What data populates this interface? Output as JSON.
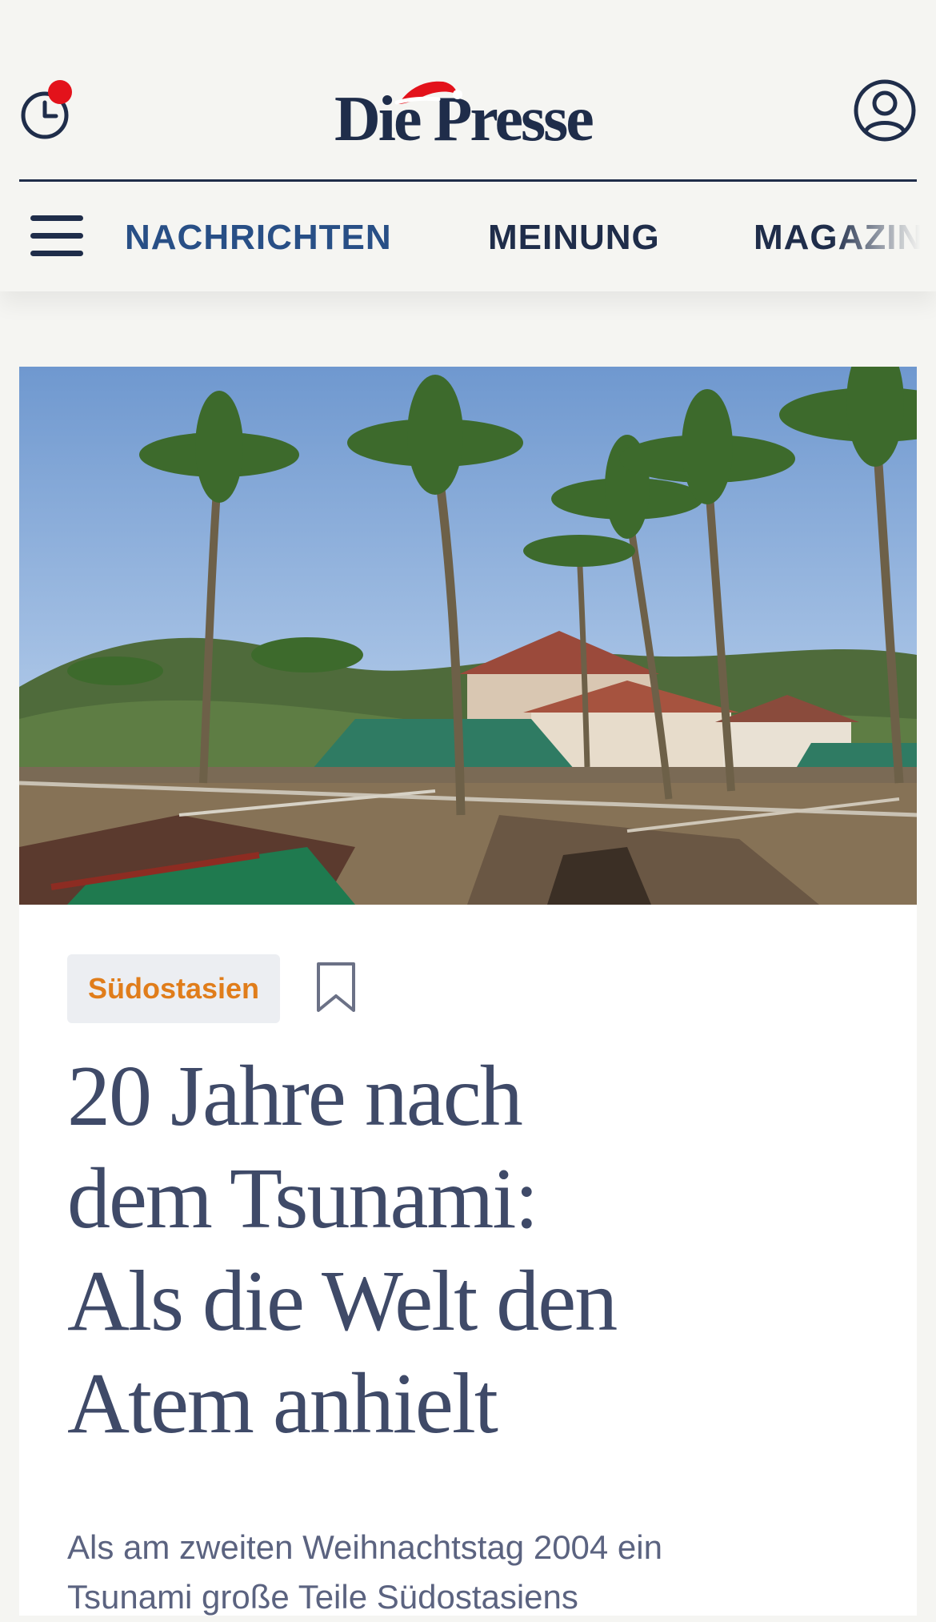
{
  "header": {
    "logo_text": "Die Presse",
    "history_icon": "clock-history-icon",
    "notification_icon": "notification-dot-icon",
    "account_icon": "user-account-icon",
    "brand_color": "#1f2d4a",
    "notification_color": "#e3121b"
  },
  "nav": {
    "menu_icon": "hamburger-menu-icon",
    "items": [
      {
        "label": "NACHRICHTEN"
      },
      {
        "label": "MEINUNG"
      },
      {
        "label": "MAGAZIN"
      }
    ],
    "active_color": "#284f86"
  },
  "article": {
    "hero_image": "tsunami-destroyed-resort-palm-trees-photo",
    "tag": "Südostasien",
    "tag_color": "#e07d1b",
    "bookmark_icon": "bookmark-icon",
    "headline_lines": [
      "20 Jahre nach",
      "dem Tsunami:",
      "Als die Welt den",
      "Atem anhielt"
    ],
    "lead_lines": [
      "Als am zweiten Weihnachtstag 2004 ein",
      "Tsunami große Teile Südostasiens"
    ]
  }
}
